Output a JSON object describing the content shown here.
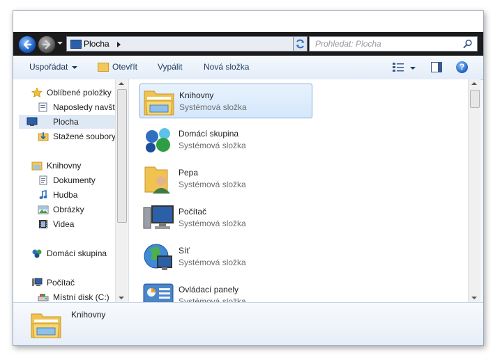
{
  "address": {
    "location": "Plocha"
  },
  "search": {
    "placeholder": "Prohledat: Plocha"
  },
  "toolbar": {
    "organize": "Uspořádat",
    "open": "Otevřít",
    "burn": "Vypálit",
    "new_folder": "Nová složka"
  },
  "nav": {
    "favorites": "Oblíbené položky",
    "recent": "Naposledy navští",
    "desktop": "Plocha",
    "downloads": "Stažené soubory",
    "libraries": "Knihovny",
    "documents": "Dokumenty",
    "music": "Hudba",
    "pictures": "Obrázky",
    "videos": "Videa",
    "homegroup": "Domácí skupina",
    "computer": "Počítač",
    "local_disk": "Místní disk (C:)"
  },
  "items": [
    {
      "name": "Knihovny",
      "type": "Systémová složka"
    },
    {
      "name": "Domácí skupina",
      "type": "Systémová složka"
    },
    {
      "name": "Pepa",
      "type": "Systémová složka"
    },
    {
      "name": "Počítač",
      "type": "Systémová složka"
    },
    {
      "name": "Síť",
      "type": "Systémová složka"
    },
    {
      "name": "Ovládací panely",
      "type": "Systémová složka"
    }
  ],
  "details": {
    "name": "Knihovny"
  },
  "colors": {
    "accent": "#1e5fbf",
    "selection": "#d5e7fb",
    "toolbar_text": "#1e395b"
  }
}
